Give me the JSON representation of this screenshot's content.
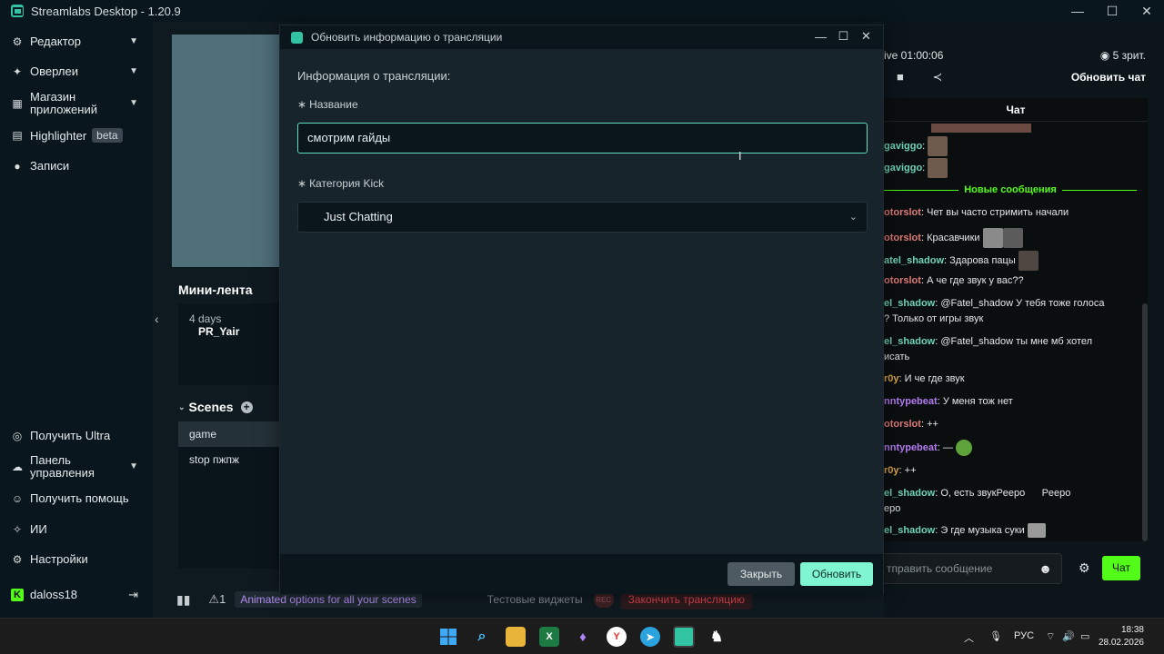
{
  "window": {
    "title": "Streamlabs Desktop - 1.20.9"
  },
  "sidebar": {
    "items": [
      {
        "label": "Редактор"
      },
      {
        "label": "Оверлеи"
      },
      {
        "label": "Магазин приложений"
      },
      {
        "label": "Highlighter",
        "badge": "beta"
      },
      {
        "label": "Записи"
      }
    ],
    "bottom_items": [
      {
        "label": "Получить Ultra"
      },
      {
        "label": "Панель управления"
      },
      {
        "label": "Получить помощь"
      },
      {
        "label": "ИИ"
      },
      {
        "label": "Настройки"
      }
    ],
    "user": {
      "name": "daloss18"
    }
  },
  "main": {
    "minifeed": {
      "title": "Мини-лента",
      "row_time": "4 days",
      "row_user": "PR_Yair"
    },
    "scenes": {
      "title": "Scenes",
      "items": [
        "game",
        "stop пжпж"
      ]
    },
    "bottombar": {
      "alert_count": "1",
      "animated_text": "Animated options for all your scenes",
      "test_widgets": "Тестовые виджеты",
      "rec_label": "REC",
      "end_stream": "Закончить трансляцию"
    }
  },
  "right_panel": {
    "live_time": "ive 01:00:06",
    "viewers": "5 зрит.",
    "refresh_chat": "Обновить чат",
    "chat_title": "Чат",
    "new_messages": "Новые сообщения",
    "messages": [
      {
        "user": "gaviggo",
        "text": "",
        "color": "#6fd3b8"
      },
      {
        "user": "gaviggo",
        "text": "",
        "color": "#6fd3b8"
      },
      {
        "user": "otorslot",
        "text": "Чет вы часто стримить начали",
        "color": "#e07a7a"
      },
      {
        "user": "otorslot",
        "text": "Красавчики",
        "color": "#e07a7a"
      },
      {
        "user": "atel_shadow",
        "text": "Здарова пацы",
        "color": "#6fd3b8"
      },
      {
        "user": "otorslot",
        "text": "А че где звук у вас??",
        "color": "#e07a7a"
      },
      {
        "user": "el_shadow",
        "text": "@Fatel_shadow У тебя тоже голоса\n? Только от игры звук",
        "color": "#6fd3b8"
      },
      {
        "user": "el_shadow",
        "text": "@Fatel_shadow ты мне мб хотел\nисать",
        "color": "#6fd3b8"
      },
      {
        "user": "r0y",
        "text": "И че где звук",
        "color": "#e0a74a"
      },
      {
        "user": "nntypebeat",
        "text": "У меня тож нет",
        "color": "#b47cf2"
      },
      {
        "user": "otorslot",
        "text": "++",
        "color": "#e07a7a"
      },
      {
        "user": "nntypebeat",
        "text": "—",
        "color": "#b47cf2"
      },
      {
        "user": "r0y",
        "text": "++",
        "color": "#e0a74a"
      },
      {
        "user": "el_shadow",
        "text": "О, есть звукPeepo      Peepo\nеро",
        "color": "#6fd3b8"
      },
      {
        "user": "el_shadow",
        "text": "Э где музыка суки",
        "color": "#6fd3b8"
      }
    ],
    "chat_placeholder": "тправить сообщение",
    "chat_button": "Чат"
  },
  "dialog": {
    "title": "Обновить информацию о трансляции",
    "section": "Информация о трансляции:",
    "name_label": "Название",
    "name_value": "смотрим гайды",
    "category_label": "Категория Kick",
    "category_value": "Just Chatting",
    "close_button": "Закрыть",
    "update_button": "Обновить"
  },
  "taskbar": {
    "lang": "РУС",
    "time": "18:38",
    "date": "28.02.2026"
  },
  "colors": {
    "accent_green": "#53fc18",
    "streamlabs_teal": "#31c3a2",
    "update_button": "#80f5d2"
  }
}
